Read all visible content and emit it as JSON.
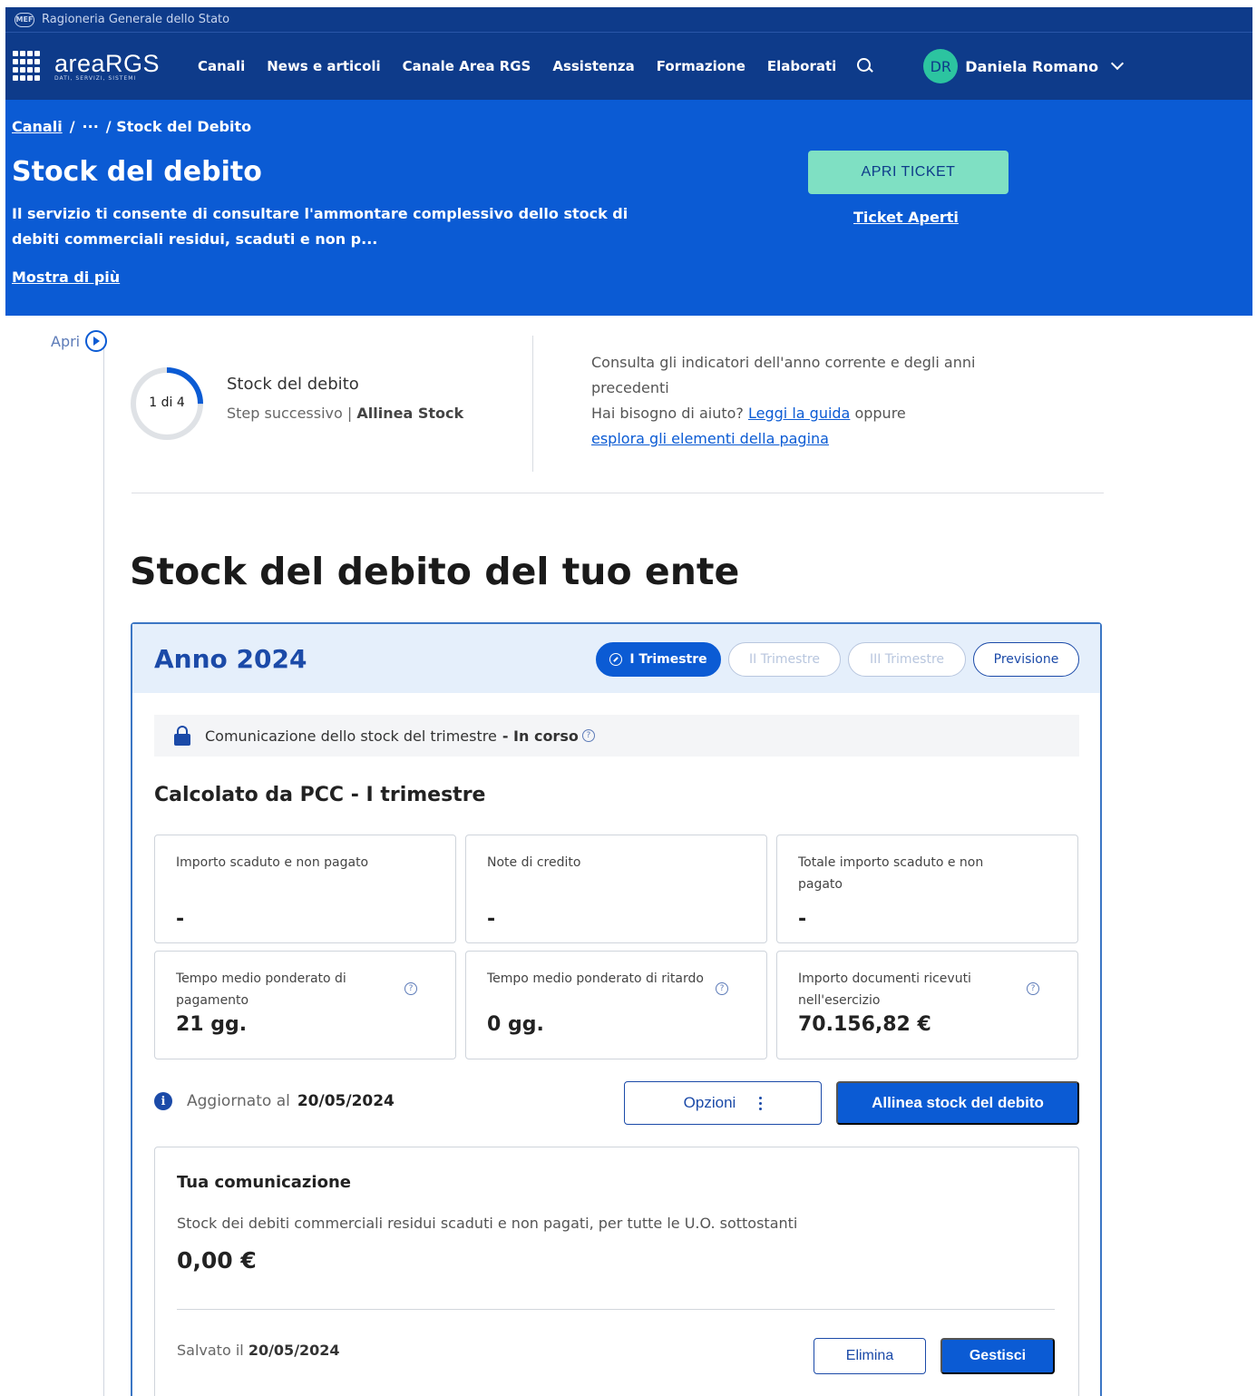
{
  "topbar": {
    "org_name": "Ragioneria Generale dello Stato",
    "logo_text": "MEF"
  },
  "nav": {
    "brand": "areaRGS",
    "brand_sub": "DATI, SERVIZI, SISTEMI",
    "links": [
      "Canali",
      "News e articoli",
      "Canale Area RGS",
      "Assistenza",
      "Formazione",
      "Elaborati"
    ],
    "user": {
      "initials": "DR",
      "name": "Daniela Romano"
    }
  },
  "hero": {
    "breadcrumb": {
      "root": "Canali",
      "sep1": "/",
      "ellipsis": "···",
      "current": "/ Stock del Debito"
    },
    "title": "Stock del debito",
    "description": "Il servizio ti consente di consultare l'ammontare complessivo dello stock di debiti commerciali residui, scaduti e non p...",
    "show_more": "Mostra di più",
    "ticket_button": "APRI TICKET",
    "ticket_link": "Ticket Aperti"
  },
  "rail": {
    "open_label": "Apri"
  },
  "step": {
    "counter": "1 di 4",
    "progress": 0.25,
    "title": "Stock del debito",
    "next_label": "Step successivo |",
    "next_value": "Allinea Stock"
  },
  "help": {
    "line1": "Consulta gli indicatori dell'anno corrente e degli anni precedenti",
    "line2": "Hai bisogno di aiuto?",
    "guide_link": "Leggi la guida",
    "or": "oppure",
    "explore_link": "esplora gli elementi della pagina"
  },
  "section_title": "Stock del debito del tuo ente",
  "card": {
    "year": "Anno 2024",
    "tabs": [
      {
        "label": "I Trimestre",
        "state": "active"
      },
      {
        "label": "II Trimestre",
        "state": "disabled"
      },
      {
        "label": "III Trimestre",
        "state": "disabled"
      },
      {
        "label": "Previsione",
        "state": "outline"
      }
    ],
    "status": {
      "text": "Comunicazione dello stock del trimestre",
      "value": "- In corso"
    },
    "calc_title": "Calcolato da PCC - I trimestre",
    "metrics": [
      {
        "label": "Importo scaduto e non pagato",
        "value": "-"
      },
      {
        "label": "Note di credito",
        "value": "-"
      },
      {
        "label": "Totale importo scaduto e non pagato",
        "value": "-"
      },
      {
        "label": "Tempo medio ponderato di pagamento",
        "value": "21 gg."
      },
      {
        "label": "Tempo medio ponderato di ritardo",
        "value": "0 gg."
      },
      {
        "label": "Importo documenti ricevuti nell'esercizio",
        "value": "70.156,82 €"
      }
    ],
    "updated": {
      "label": "Aggiornato al",
      "date": "20/05/2024"
    },
    "options_button": "Opzioni",
    "align_button": "Allinea stock del debito",
    "communication": {
      "title": "Tua comunicazione",
      "description": "Stock dei debiti commerciali residui scaduti e non pagati, per tutte le U.O. sottostanti",
      "amount": "0,00 €",
      "saved_label": "Salvato il",
      "saved_date": "20/05/2024",
      "delete_button": "Elimina",
      "manage_button": "Gestisci"
    }
  },
  "colors": {
    "nav": "#0e3b8a",
    "hero": "#0b5bd4",
    "accent": "#7fe0c3",
    "primary": "#1b4aa8"
  }
}
